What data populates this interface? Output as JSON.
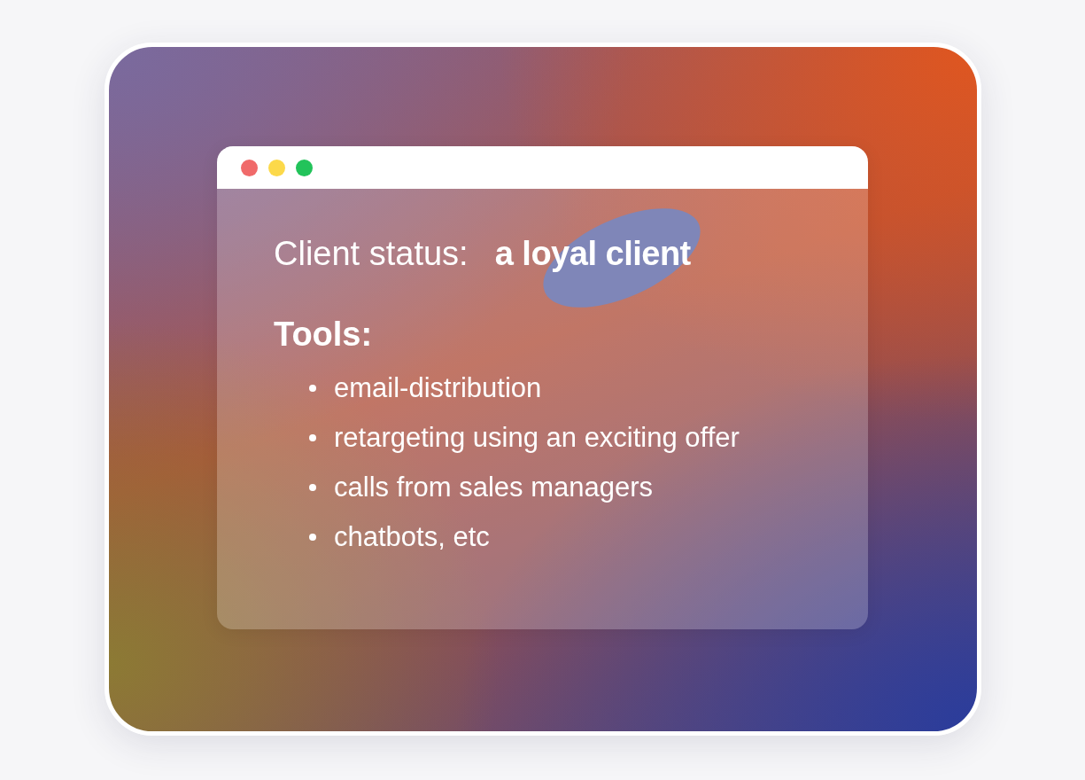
{
  "status": {
    "label": "Client status:",
    "value": "a loyal client"
  },
  "tools": {
    "heading": "Tools:",
    "items": [
      {
        "text": "email-distribution"
      },
      {
        "text": "retargeting using an exciting offer"
      },
      {
        "text": "calls from sales managers"
      },
      {
        "text": "chatbots, etc"
      }
    ]
  }
}
